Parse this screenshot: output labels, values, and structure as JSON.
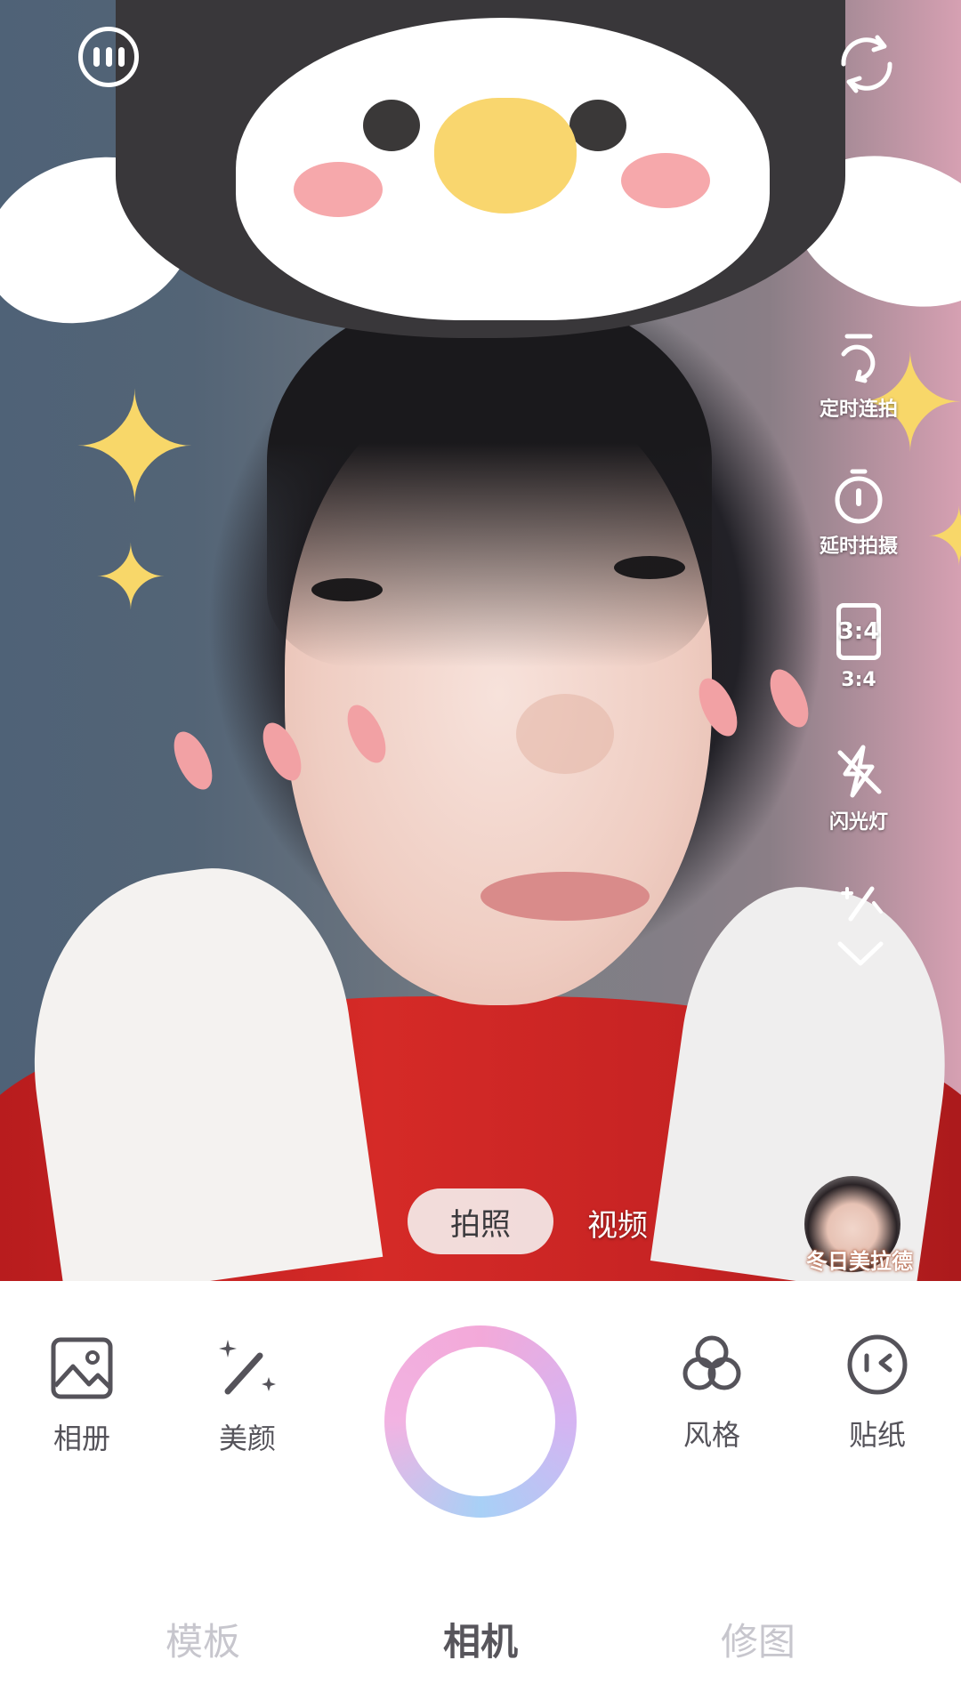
{
  "right_tools": [
    {
      "label": "定时连拍",
      "icon": "timer-burst-icon"
    },
    {
      "label": "延时拍摄",
      "icon": "stopwatch-icon"
    },
    {
      "label": "3:4",
      "icon": "aspect-ratio-icon",
      "badge": "3:4"
    },
    {
      "label": "闪光灯",
      "icon": "flash-off-icon"
    }
  ],
  "modes": {
    "photo": "拍照",
    "video": "视频",
    "selected": "拍照"
  },
  "filter": {
    "name": "冬日美拉德"
  },
  "bottom_bar": {
    "album": "相册",
    "beauty": "美颜",
    "style": "风格",
    "sticker": "贴纸"
  },
  "nav_tabs": [
    {
      "label": "模板",
      "active": false
    },
    {
      "label": "相机",
      "active": true
    },
    {
      "label": "修图",
      "active": false
    }
  ],
  "colors": {
    "shutter_gradient": [
      "#f3a9d9",
      "#d5b4f2",
      "#a8d0f6"
    ],
    "icon_gray": "#55535a",
    "nav_inactive": "#c7c6cd"
  }
}
